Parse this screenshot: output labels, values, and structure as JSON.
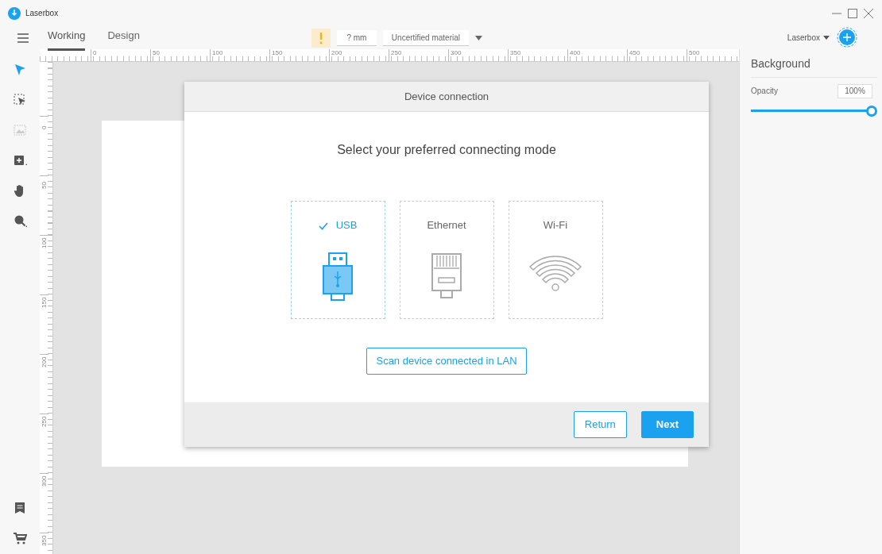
{
  "window": {
    "title": "Laserbox"
  },
  "tabs": [
    {
      "label": "Working",
      "selected": true
    },
    {
      "label": "Design",
      "selected": false
    }
  ],
  "material_bar": {
    "thickness": "? mm",
    "material": "Uncertified material"
  },
  "device_menu": {
    "label": "Laserbox"
  },
  "tools": [
    {
      "kind": "pointer",
      "selected": true,
      "disabled": false
    },
    {
      "kind": "select",
      "selected": false,
      "disabled": false
    },
    {
      "kind": "image",
      "selected": false,
      "disabled": true
    },
    {
      "kind": "add",
      "selected": false,
      "disabled": false
    },
    {
      "kind": "hand",
      "selected": false,
      "disabled": false
    },
    {
      "kind": "zoom",
      "selected": false,
      "disabled": false
    }
  ],
  "bottom_tools": [
    {
      "kind": "notes"
    },
    {
      "kind": "cart"
    }
  ],
  "ruler": {
    "horizontal": [
      "0",
      "50",
      "100",
      "150",
      "200",
      "250",
      "300",
      "350",
      "400",
      "450",
      "500"
    ],
    "vertical": [
      "0",
      "50",
      "100",
      "150",
      "200",
      "250",
      "300",
      "350"
    ]
  },
  "dialog": {
    "title": "Device connection",
    "heading": "Select your preferred connecting mode",
    "modes": [
      {
        "label": "USB",
        "kind": "usb",
        "selected": true
      },
      {
        "label": "Ethernet",
        "kind": "ethernet",
        "selected": false
      },
      {
        "label": "Wi-Fi",
        "kind": "wifi",
        "selected": false
      }
    ],
    "scan_button": "Scan device connected in LAN",
    "return_button": "Return",
    "next_button": "Next"
  },
  "panel": {
    "title": "Background",
    "opacity_label": "Opacity",
    "opacity_value": "100%",
    "level": 1
  }
}
